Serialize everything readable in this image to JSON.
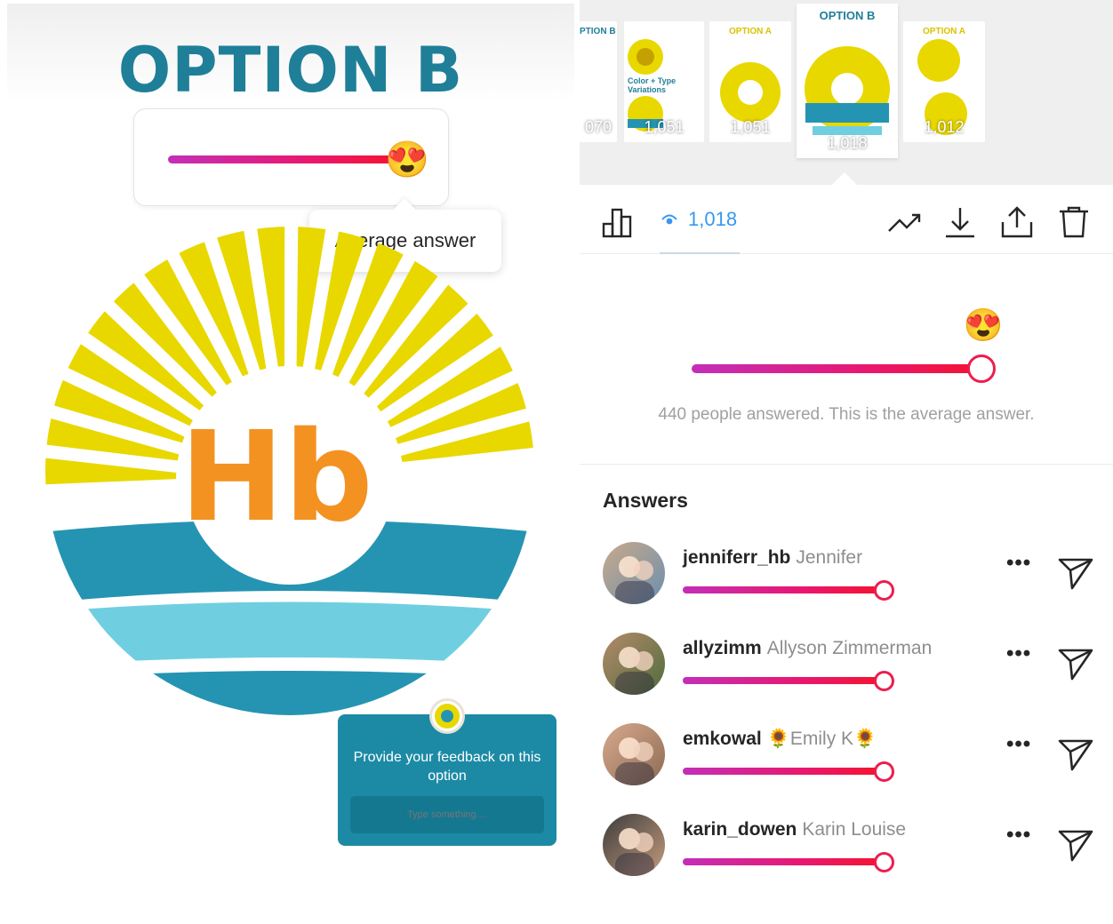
{
  "story": {
    "title": "OPTION B",
    "slider_emoji": "😍",
    "tooltip": "Average answer",
    "logo_letters": "Hb",
    "feedback_prompt": "Provide your feedback on this option",
    "feedback_placeholder": "Type something....",
    "average_fraction": 0.97
  },
  "thumbnails": [
    {
      "label": "PTION B",
      "views": "070"
    },
    {
      "label": "Color + Type Variations",
      "views": "1,051"
    },
    {
      "label": "OPTION A",
      "views": "1,051"
    },
    {
      "label": "OPTION B",
      "views": "1,018",
      "active": true
    },
    {
      "label": "OPTION A",
      "views": "1,012"
    }
  ],
  "toolbar": {
    "views": "1,018",
    "icons": [
      "bar-chart-icon",
      "eye-icon",
      "trend-icon",
      "download-icon",
      "share-icon",
      "trash-icon"
    ]
  },
  "summary": {
    "emoji": "😍",
    "caption": "440 people answered. This is the average answer.",
    "average_fraction": 0.97
  },
  "answers_title": "Answers",
  "answers": [
    {
      "username": "jenniferr_hb",
      "name": "Jennifer",
      "fraction": 0.99
    },
    {
      "username": "allyzimm",
      "name": "Allyson Zimmerman",
      "fraction": 0.99
    },
    {
      "username": "emkowal",
      "name": "🌻Emily K🌻",
      "fraction": 0.99
    },
    {
      "username": "karin_dowen",
      "name": "Karin Louise",
      "fraction": 0.99
    }
  ],
  "colors": {
    "brand_teal": "#1f7f98",
    "sun_yellow": "#e8d800",
    "letters_orange": "#f39221",
    "link_blue": "#3897f0",
    "slider_start": "#c32fb8",
    "slider_end": "#f5132c"
  }
}
